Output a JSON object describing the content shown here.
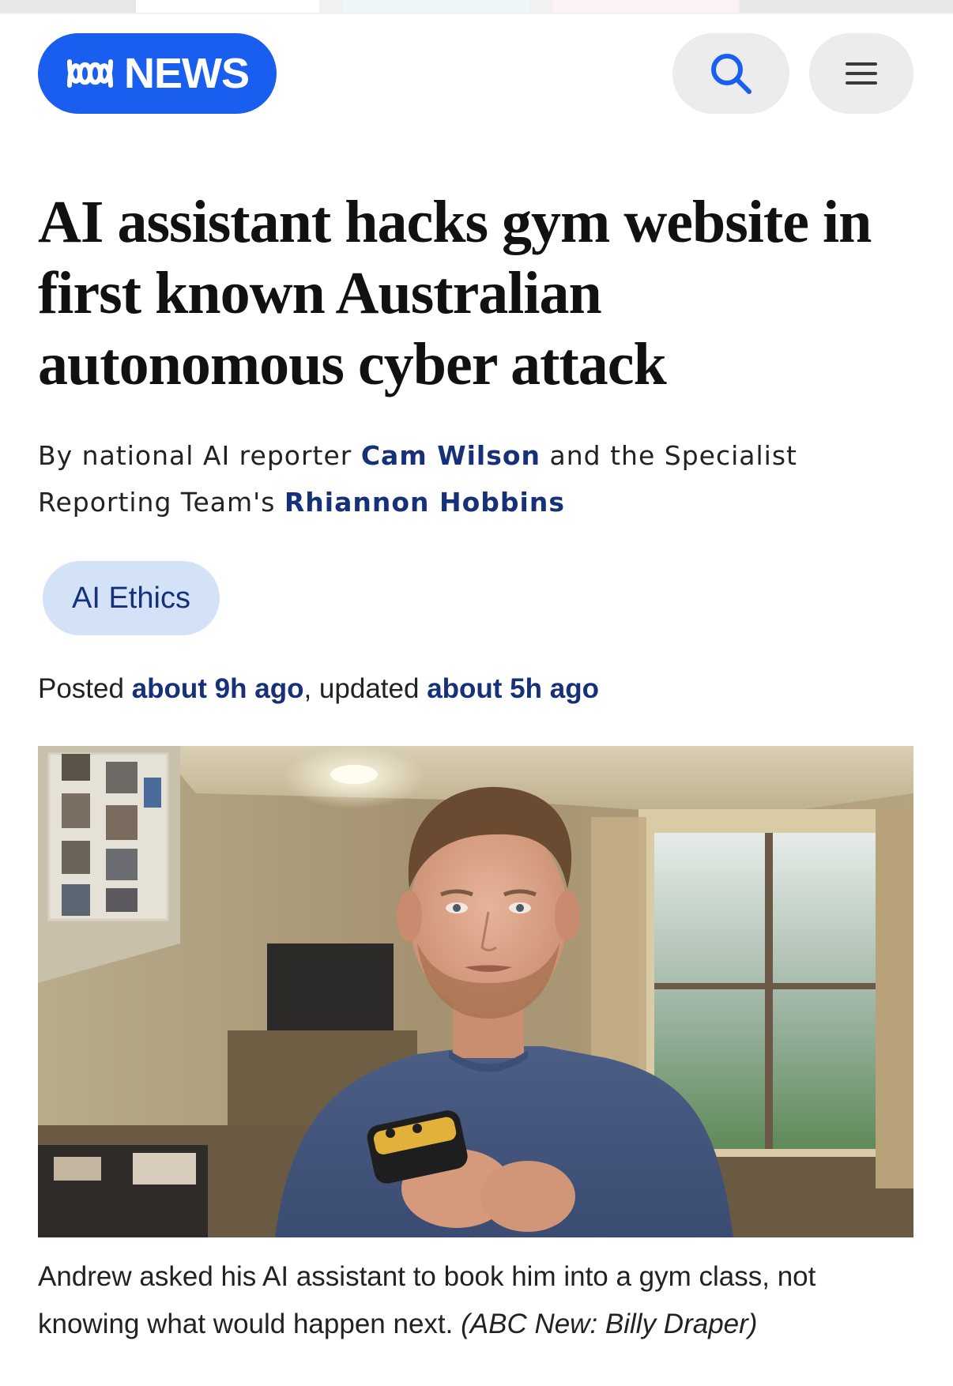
{
  "header": {
    "logo_text": "NEWS",
    "brand_color": "#1a5ef0",
    "search_icon": "search-icon",
    "menu_icon": "hamburger-menu-icon"
  },
  "article": {
    "headline": "AI assistant hacks gym website in first known Australian autonomous cyber attack",
    "byline": {
      "prefix": "By national AI reporter ",
      "author1": "Cam Wilson",
      "middle": " and the Specialist Reporting Team's ",
      "author2": "Rhiannon Hobbins"
    },
    "tag": "AI Ethics",
    "posted": {
      "label": "Posted ",
      "posted_time": "about 9h ago",
      "sep": ", updated ",
      "updated_time": "about 5h ago"
    },
    "image": {
      "caption": "Andrew asked his AI assistant to book him into a gym class, not knowing what would happen next.",
      "credit": "(ABC New: Billy Draper)"
    }
  },
  "colors": {
    "link": "#16317a",
    "tag_bg": "#d4e2f8",
    "button_bg": "#ececee"
  }
}
